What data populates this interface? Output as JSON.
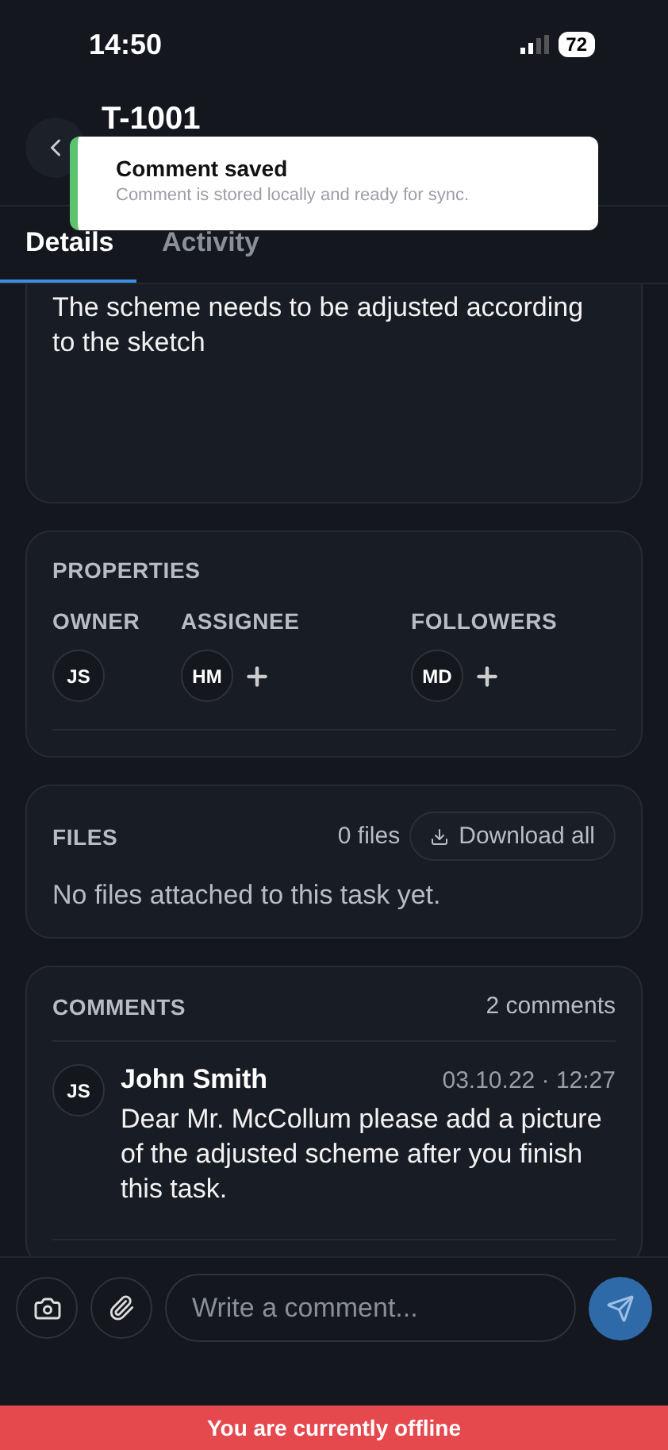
{
  "status_bar": {
    "time": "14:50",
    "battery": "72"
  },
  "header": {
    "title": "T-1001"
  },
  "toast": {
    "title": "Comment saved",
    "message": "Comment is stored locally and ready for sync."
  },
  "tabs": [
    {
      "label": "Details",
      "selected": true
    },
    {
      "label": "Activity",
      "selected": false
    }
  ],
  "description": {
    "text": "The scheme needs to be adjusted according to the sketch"
  },
  "properties": {
    "heading": "PROPERTIES",
    "groups": [
      {
        "label": "OWNER",
        "people": [
          "JS"
        ],
        "can_add": false
      },
      {
        "label": "ASSIGNEE",
        "people": [
          "HM"
        ],
        "can_add": true
      },
      {
        "label": "FOLLOWERS",
        "people": [
          "MD"
        ],
        "can_add": true
      }
    ]
  },
  "files": {
    "heading": "FILES",
    "count": "0 files",
    "download": "Download all",
    "empty": "No files attached to this task yet."
  },
  "comments": {
    "heading": "COMMENTS",
    "count": "2 comments",
    "items": [
      {
        "initials": "JS",
        "author": "John Smith",
        "time": "03.10.22 · 12:27",
        "text": "Dear Mr. McCollum please add a picture of the adjusted scheme after you finish this task."
      }
    ]
  },
  "composer": {
    "placeholder": "Write a comment..."
  },
  "offline_banner": "You are currently offline"
}
